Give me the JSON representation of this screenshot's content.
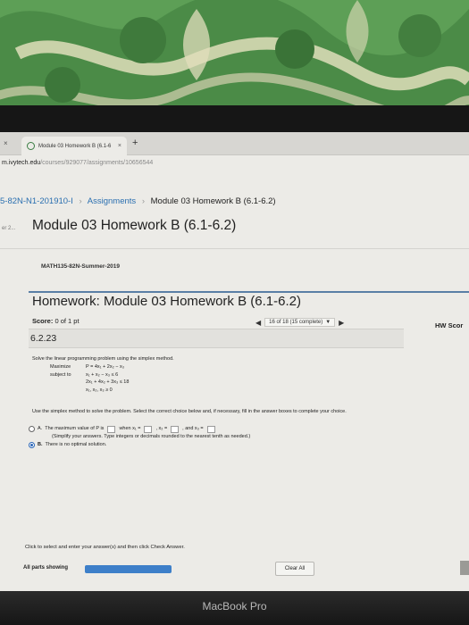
{
  "browser": {
    "tab_title": "Module 03 Homework B (6.1-6",
    "tab_close": "×",
    "left_close": "×",
    "new_tab": "+",
    "url_host": "m.ivytech.edu",
    "url_path": "/courses/929077/assignments/10656544"
  },
  "breadcrumb": {
    "course": "5-82N-N1-201910-I",
    "assignments": "Assignments",
    "current": "Module 03 Homework B (6.1-6.2)",
    "separator": "›"
  },
  "left_tag": "er 2...",
  "page_title": "Module 03 Homework B (6.1-6.2)",
  "course_code": "MATH135-82N-Summer-2019",
  "homework": {
    "title": "Homework: Module 03 Homework B (6.1-6.2)",
    "score_label": "Score:",
    "score_value": "0 of 1 pt",
    "nav_progress": "16 of 18 (15 complete)",
    "hw_score_label": "HW Scor",
    "question_number": "6.2.23"
  },
  "problem": {
    "statement": "Solve the linear programming problem using the simplex method.",
    "maximize_label": "Maximize",
    "objective": "P = 4x₁ + 2x₂ − x₃",
    "subject_label": "subject to",
    "constraints": [
      "x₁ + x₂ − x₃ ≤ 6",
      "2x₁ + 4x₂ + 3x₃ ≤ 18",
      "x₁, x₂, x₃ ≥ 0"
    ],
    "instruction": "Use the simplex method to solve the problem. Select the correct choice below and, if necessary, fill in the answer boxes to complete your choice."
  },
  "options": {
    "a_prefix": "A.",
    "a_text1": "The maximum value of P is",
    "a_text2": "when x₁ =",
    "a_text3": ", x₂ =",
    "a_text4": ", and x₃ =",
    "a_note": "(Simplify your answers. Type integers or decimals rounded to the nearest tenth as needed.)",
    "b_prefix": "B.",
    "b_text": "There is no optimal solution.",
    "selected": "B"
  },
  "footer": {
    "click_text": "Click to select and enter your answer(s) and then click Check Answer.",
    "all_parts": "All parts showing",
    "clear_all": "Clear All",
    "progress": 1.0
  },
  "device_label": "MacBook Pro",
  "colors": {
    "accent": "#2a66b8",
    "link": "#2a6fb0",
    "fabric": "#4f8f4a"
  }
}
